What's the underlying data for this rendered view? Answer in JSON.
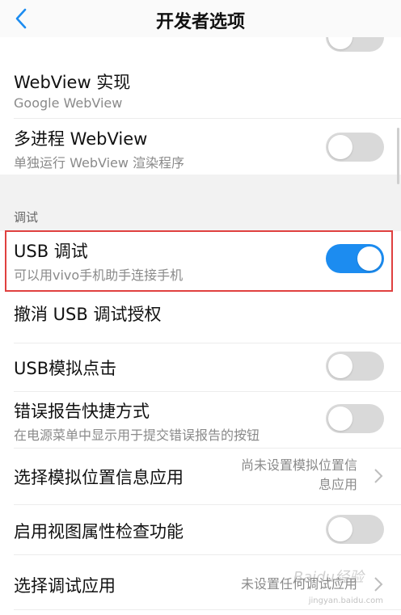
{
  "header": {
    "title": "开发者选项",
    "back_icon": "chevron-left-icon"
  },
  "rows": {
    "webview_impl": {
      "title": "WebView 实现",
      "subtitle": "Google WebView"
    },
    "multiprocess_webview": {
      "title": "多进程 WebView",
      "subtitle": "单独运行 WebView 渲染程序",
      "toggle": "off"
    },
    "section_debug": "调试",
    "usb_debug": {
      "title": "USB 调试",
      "subtitle": "可以用vivo手机助手连接手机",
      "toggle": "on"
    },
    "revoke_usb": {
      "title": "撤消 USB 调试授权"
    },
    "usb_tap": {
      "title": "USB模拟点击",
      "toggle": "off"
    },
    "bug_report": {
      "title": "错误报告快捷方式",
      "subtitle": "在电源菜单中显示用于提交错误报告的按钮",
      "toggle": "off"
    },
    "mock_location": {
      "title": "选择模拟位置信息应用",
      "value_line1": "尚未设置模拟位置信",
      "value_line2": "息应用"
    },
    "view_attr": {
      "title": "启用视图属性检查功能",
      "toggle": "off"
    },
    "debug_app": {
      "title": "选择调试应用",
      "value": "未设置任何调试应用"
    }
  },
  "colors": {
    "accent": "#1c8cf0",
    "highlight": "#e0403f",
    "toggle_off": "#d9d9d9"
  },
  "watermark": {
    "text": "Baidu经验",
    "url": "jingyan.baidu.com"
  }
}
